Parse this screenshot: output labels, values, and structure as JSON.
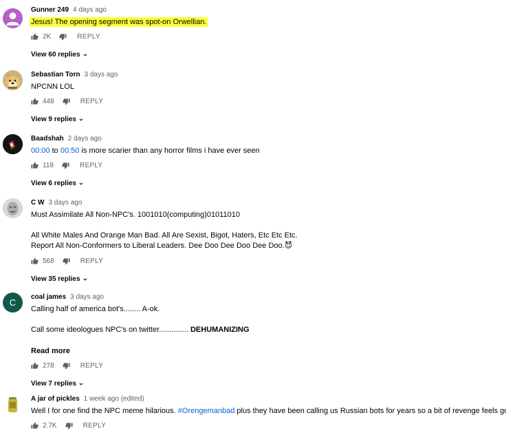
{
  "ui": {
    "reply_label": "REPLY"
  },
  "comments": [
    {
      "author": "Gunner 249",
      "time": "4 days ago",
      "text": "Jesus!  The opening segment was spot-on Orwellian.",
      "likes": "2K",
      "replies_label": "View 60 replies"
    },
    {
      "author": "Sebastian Torn",
      "time": "3 days ago",
      "text": "NPCNN LOL",
      "likes": "448",
      "replies_label": "View 9 replies"
    },
    {
      "author": "Baadshah",
      "time": "2 days ago",
      "timestamp1": "00:00",
      "to": "to",
      "timestamp2": "00:50",
      "text_rest": "is more scarier than any horror films i have ever seen",
      "likes": "118",
      "replies_label": "View 6 replies"
    },
    {
      "author": "C W",
      "time": "3 days ago",
      "line1": "Must Assimilate All Non-NPC's. 1001010(computing)01011010",
      "line2": "All White Males And Orange Man Bad. All Are Sexist, Bigot, Haters, Etc Etc Etc.",
      "line3": "Report All Non-Conformers to Liberal Leaders. Dee Doo Dee Doo Dee Doo.",
      "emoji": "😈",
      "likes": "568",
      "replies_label": "View 35 replies"
    },
    {
      "author": "coal james",
      "time": "3 days ago",
      "avatar_letter": "C",
      "line1": "Calling half of america bot's........ A-ok.",
      "line2": "Call some ideologues NPC's on twitter..............",
      "line2_bold": "DEHUMANIZING",
      "read_more": "Read more",
      "likes": "278",
      "replies_label": "View 7 replies"
    },
    {
      "author": "A jar of pickles",
      "time": "1 week ago (edited)",
      "text_pre": "Well I for one find the NPC meme hilarious.",
      "hashtag": "#Orengemanbad",
      "text_post": "plus they have been calling us Russian bots for years so a bit of revenge feels good",
      "likes": "2.7K"
    }
  ],
  "colors": {
    "highlight": "#fbff3c",
    "link": "#065fd4",
    "meta": "#606060",
    "avatar_purple": "#b65fc7",
    "avatar_green": "#0e5a4b"
  }
}
